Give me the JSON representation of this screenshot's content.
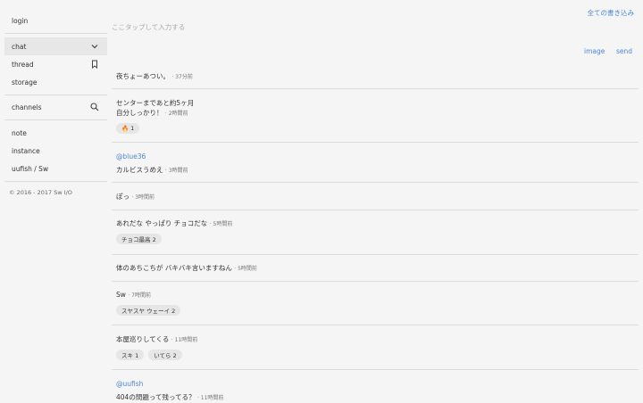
{
  "sidebar": {
    "items": [
      {
        "label": "login"
      },
      {
        "label": "chat"
      },
      {
        "label": "thread"
      },
      {
        "label": "storage"
      },
      {
        "label": "channels"
      },
      {
        "label": "note"
      },
      {
        "label": "instance"
      },
      {
        "label": "uufish / Sw"
      }
    ],
    "copyright": "© 2016 - 2017 Sw I/O"
  },
  "header": {
    "write_all": "全ての書き込み",
    "input_placeholder": "ここタップして入力する",
    "image_label": "image",
    "send_label": "send"
  },
  "messages": [
    {
      "text": "夜ちょーあつい。",
      "time": "37分前"
    },
    {
      "lines": [
        "センターまであと約5ヶ月",
        "自分しっかり！"
      ],
      "time": "2時間前",
      "reactions": [
        {
          "label": "🔥 1"
        }
      ]
    },
    {
      "author": "@blue36",
      "text": "カルビスうめえ",
      "time": "3時間前"
    },
    {
      "text": "ぽっ",
      "time": "3時間前"
    },
    {
      "text": "あれだな やっぱり チョコだな",
      "time": "5時間前",
      "reactions": [
        {
          "label": "チョコ最高 2"
        }
      ]
    },
    {
      "text": "体のあちこちが バキバキ言いますねん",
      "time": "5時間前"
    },
    {
      "text": "Sw",
      "time": "7時間前",
      "reactions": [
        {
          "label": "スヤスヤ ウェーイ 2"
        }
      ]
    },
    {
      "text": "本屋巡りしてくる",
      "time": "11時間前",
      "reactions": [
        {
          "label": "スキ 1"
        },
        {
          "label": "いてら 2"
        }
      ]
    },
    {
      "author": "@uufish",
      "text": "404の問題って残ってる？",
      "time": "11時間前"
    }
  ]
}
